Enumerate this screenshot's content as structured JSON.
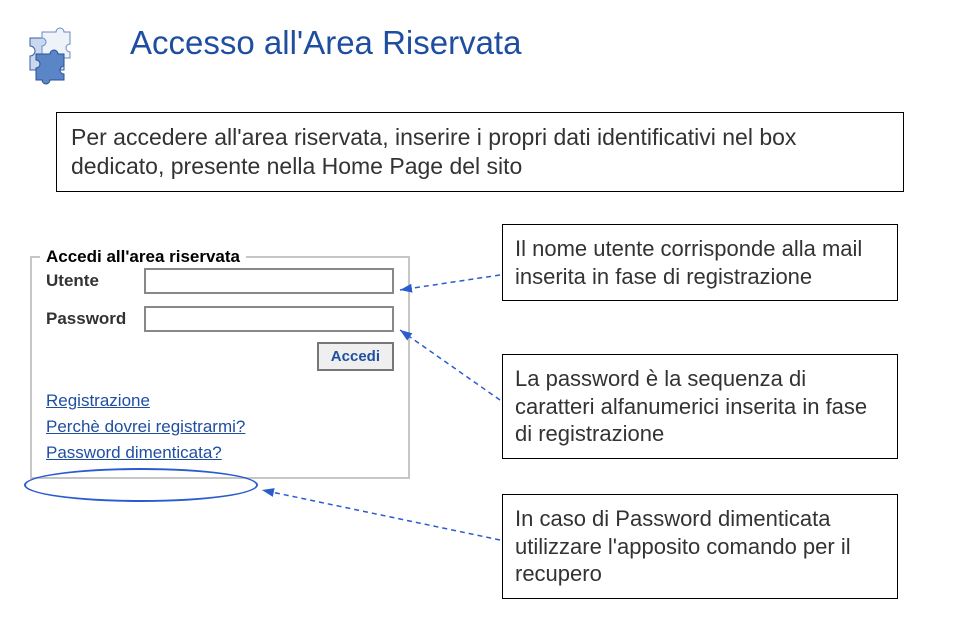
{
  "title": "Accesso all'Area Riservata",
  "intro": "Per accedere all'area riservata, inserire i propri dati identificativi nel box dedicato, presente nella Home Page del sito",
  "login": {
    "header": "Accedi all'area riservata",
    "user_label": "Utente",
    "pass_label": "Password",
    "button": "Accedi",
    "links": {
      "register": "Registrazione",
      "why": "Perchè dovrei registrarmi?",
      "forgot": "Password dimenticata?"
    }
  },
  "notes": {
    "n1": "Il nome utente corrisponde alla mail inserita in fase di registrazione",
    "n2": "La password è la sequenza di caratteri alfanumerici inserita in fase di registrazione",
    "n3": "In caso di Password dimenticata utilizzare l'apposito comando per il recupero"
  }
}
